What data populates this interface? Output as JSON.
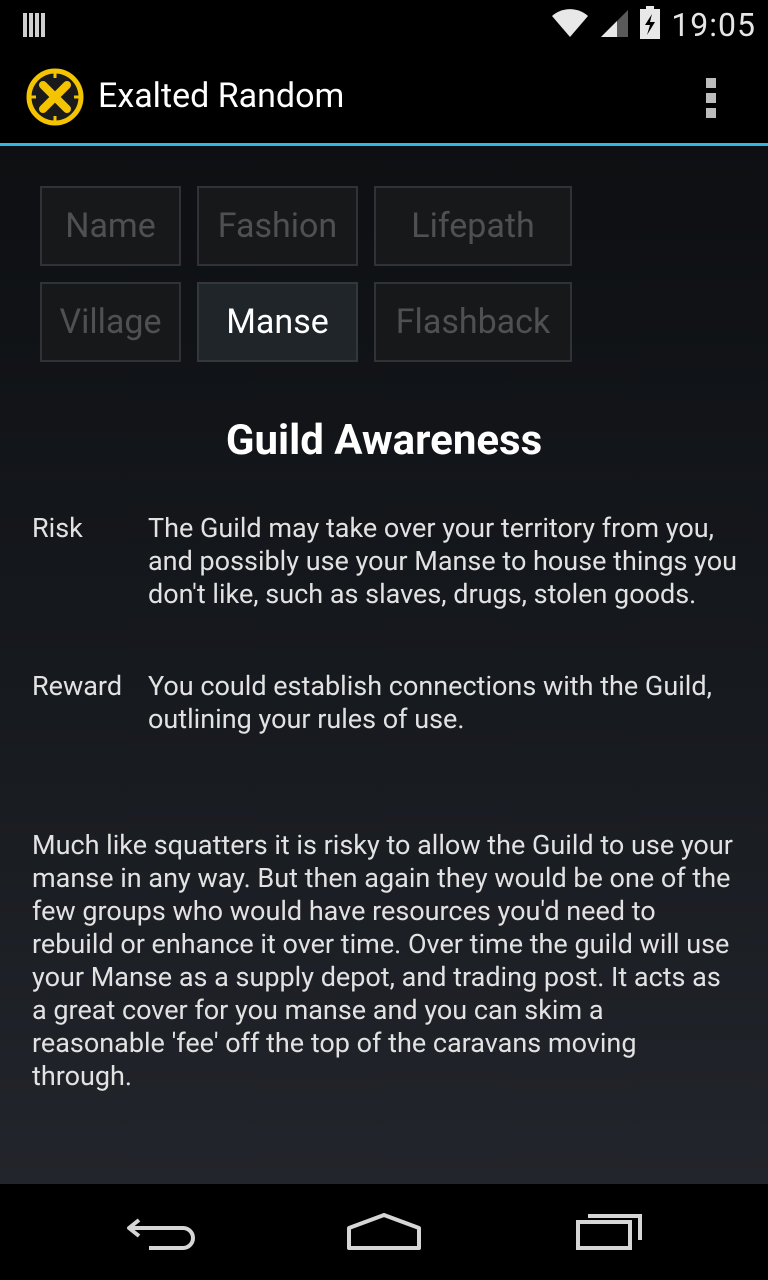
{
  "status_bar": {
    "time": "19:05"
  },
  "action_bar": {
    "title": "Exalted Random",
    "overflow_icon": "overflow-menu-icon"
  },
  "tabs": [
    {
      "label": "Name",
      "active": false
    },
    {
      "label": "Fashion",
      "active": false
    },
    {
      "label": "Lifepath",
      "active": false
    },
    {
      "label": "Village",
      "active": false
    },
    {
      "label": "Manse",
      "active": true
    },
    {
      "label": "Flashback",
      "active": false
    }
  ],
  "main": {
    "title": "Guild Awareness",
    "risk_label": "Risk",
    "risk_text": "The Guild may take over your territory from you, and possibly use your Manse to house things you don't like, such as slaves, drugs, stolen goods.",
    "reward_label": "Reward",
    "reward_text": "You could establish connections with the Guild, outlining your rules of use.",
    "description": "Much like squatters it is risky to allow the Guild to use your manse in any way. But then again they would be one of the few groups who would have resources you'd need to rebuild or enhance it over time. Over time the guild will use your Manse as a supply depot, and trading post. It acts as a great cover for you manse and you can skim a reasonable 'fee' off the top of the caravans moving through."
  },
  "colors": {
    "accent": "#33b5e5",
    "icon_yellow": "#f5c400"
  }
}
